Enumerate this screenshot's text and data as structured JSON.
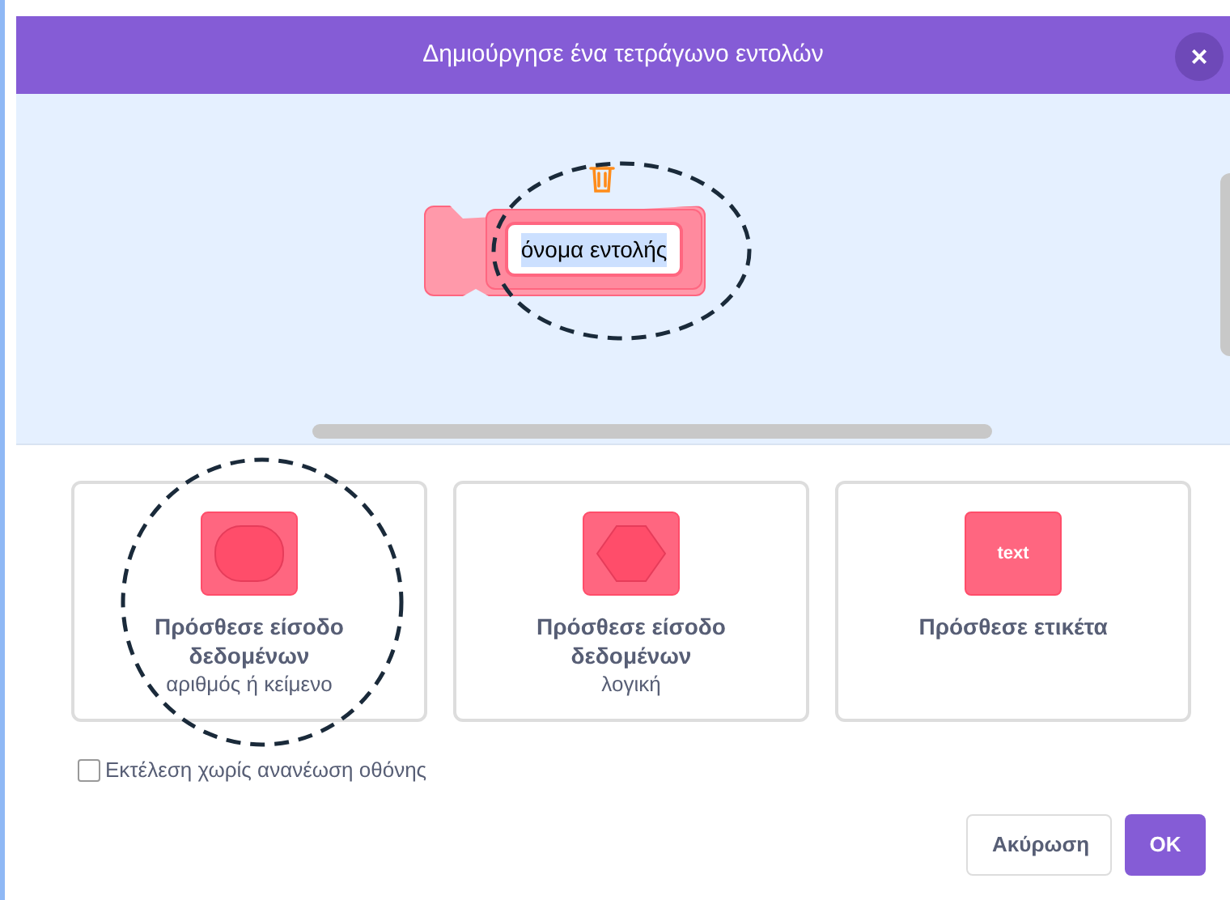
{
  "window": {
    "title": "Δημιούργησε ένα τετράγωνο εντολών",
    "close_label": "×"
  },
  "block": {
    "name_value": "όνομα εντολής"
  },
  "options": [
    {
      "kind": "number_text",
      "title": "Πρόσθεσε είσοδο δεδομένων",
      "subtitle": "αριθμός ή κείμενο"
    },
    {
      "kind": "boolean",
      "title": "Πρόσθεσε είσοδο δεδομένων",
      "subtitle": "λογική"
    },
    {
      "kind": "label",
      "icon_text": "text",
      "title": "Πρόσθεσε ετικέτα"
    }
  ],
  "run_without_refresh": {
    "label": "Εκτέλεση χωρίς ανανέωση οθόνης",
    "checked": false
  },
  "buttons": [
    {
      "kind": "secondary",
      "label": "Ακύρωση"
    },
    {
      "kind": "primary",
      "label": "OK"
    }
  ]
}
